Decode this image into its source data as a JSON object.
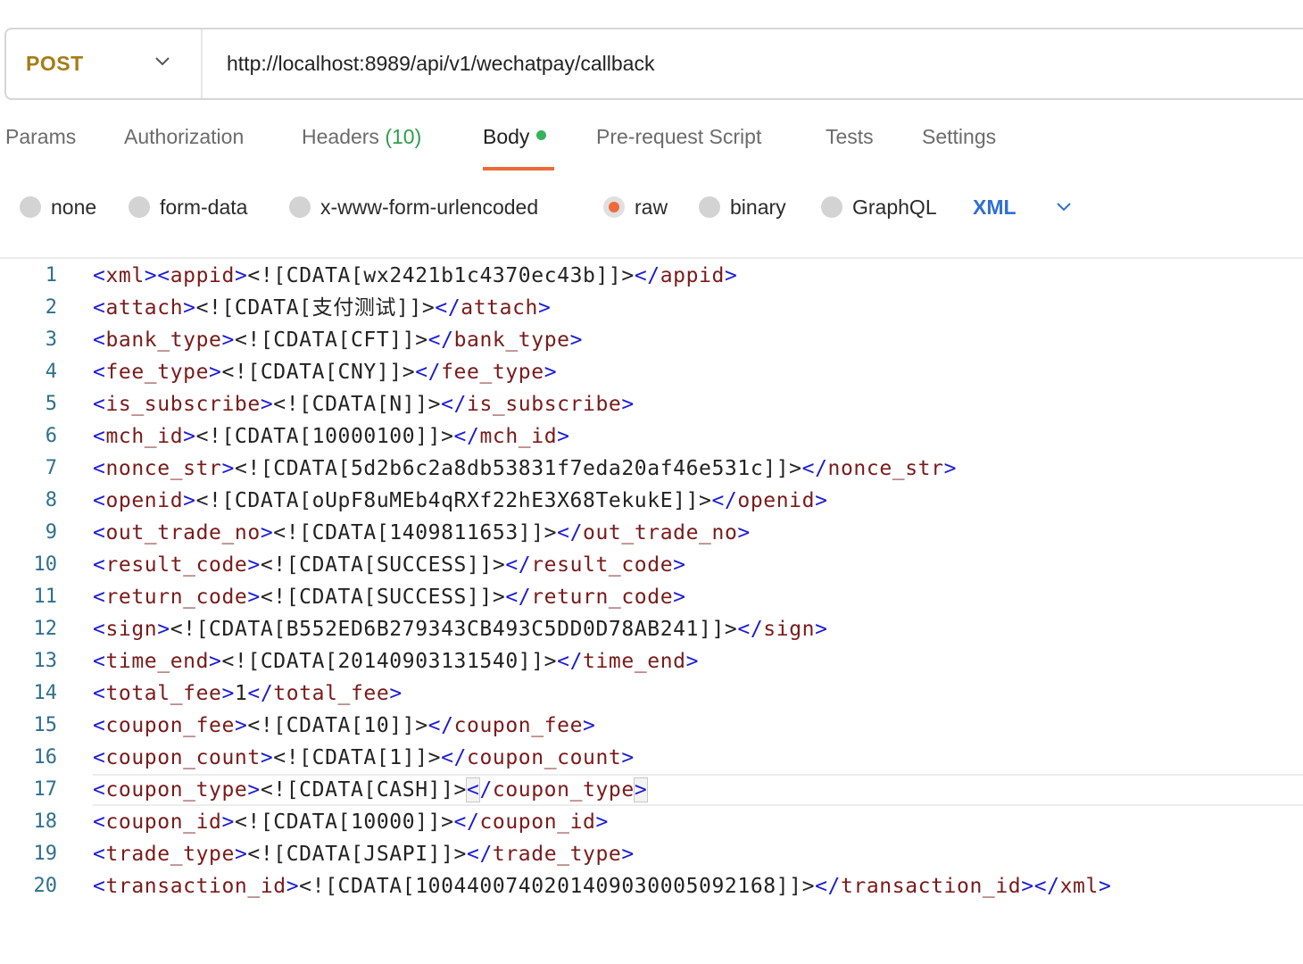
{
  "request": {
    "method": "POST",
    "url": "http://localhost:8989/api/v1/wechatpay/callback"
  },
  "tabs": [
    {
      "label": "Params"
    },
    {
      "label": "Authorization"
    },
    {
      "label": "Headers",
      "count": "(10)"
    },
    {
      "label": "Body",
      "active": true
    },
    {
      "label": "Pre-request Script"
    },
    {
      "label": "Tests"
    },
    {
      "label": "Settings"
    }
  ],
  "body_types": [
    {
      "label": "none"
    },
    {
      "label": "form-data"
    },
    {
      "label": "x-www-form-urlencoded"
    },
    {
      "label": "raw",
      "selected": true
    },
    {
      "label": "binary"
    },
    {
      "label": "GraphQL"
    }
  ],
  "language": "XML",
  "colors": {
    "method": "#a67c15",
    "active_underline": "#ec6a39",
    "body_dot": "#34b35a",
    "count": "#2e9e4a",
    "language": "#2f6fd4",
    "xml_punct": "#1a1ad6",
    "xml_tag": "#7a1a1a",
    "line_number": "#2e6f8e"
  },
  "editor": {
    "current_line": 17,
    "lines": [
      {
        "n": "1",
        "pre": "",
        "open": "xml><appid",
        "val": "<![CDATA[wx2421b1c4370ec43b]]>",
        "close": "appid"
      },
      {
        "n": "2",
        "pre": "",
        "open": "attach",
        "val": "<![CDATA[支付测试]]>",
        "close": "attach"
      },
      {
        "n": "3",
        "pre": "",
        "open": "bank_type",
        "val": "<![CDATA[CFT]]>",
        "close": "bank_type"
      },
      {
        "n": "4",
        "pre": "",
        "open": "fee_type",
        "val": "<![CDATA[CNY]]>",
        "close": "fee_type"
      },
      {
        "n": "5",
        "pre": "",
        "open": "is_subscribe",
        "val": "<![CDATA[N]]>",
        "close": "is_subscribe"
      },
      {
        "n": "6",
        "pre": "",
        "open": "mch_id",
        "val": "<![CDATA[10000100]]>",
        "close": "mch_id"
      },
      {
        "n": "7",
        "pre": "",
        "open": "nonce_str",
        "val": "<![CDATA[5d2b6c2a8db53831f7eda20af46e531c]]>",
        "close": "nonce_str"
      },
      {
        "n": "8",
        "pre": "",
        "open": "openid",
        "val": "<![CDATA[oUpF8uMEb4qRXf22hE3X68TekukE]]>",
        "close": "openid"
      },
      {
        "n": "9",
        "pre": "",
        "open": "out_trade_no",
        "val": "<![CDATA[1409811653]]>",
        "close": "out_trade_no"
      },
      {
        "n": "10",
        "pre": "",
        "open": "result_code",
        "val": "<![CDATA[SUCCESS]]>",
        "close": "result_code"
      },
      {
        "n": "11",
        "pre": "",
        "open": "return_code",
        "val": "<![CDATA[SUCCESS]]>",
        "close": "return_code"
      },
      {
        "n": "12",
        "pre": "",
        "open": "sign",
        "val": "<![CDATA[B552ED6B279343CB493C5DD0D78AB241]]>",
        "close": "sign"
      },
      {
        "n": "13",
        "pre": "",
        "open": "time_end",
        "val": "<![CDATA[20140903131540]]>",
        "close": "time_end"
      },
      {
        "n": "14",
        "pre": "",
        "open": "total_fee",
        "val": "1",
        "close": "total_fee"
      },
      {
        "n": "15",
        "pre": "",
        "open": "coupon_fee",
        "val": "<![CDATA[10]]>",
        "close": "coupon_fee"
      },
      {
        "n": "16",
        "pre": "",
        "open": "coupon_count",
        "val": "<![CDATA[1]]>",
        "close": "coupon_count"
      },
      {
        "n": "17",
        "pre": "",
        "open": "coupon_type",
        "val": "<![CDATA[CASH]]>",
        "close": "coupon_type"
      },
      {
        "n": "18",
        "pre": "",
        "open": "coupon_id",
        "val": "<![CDATA[10000]]>",
        "close": "coupon_id"
      },
      {
        "n": "19",
        "pre": "",
        "open": "trade_type",
        "val": "<![CDATA[JSAPI]]>",
        "close": "trade_type"
      },
      {
        "n": "20",
        "pre": "",
        "open": "transaction_id",
        "val": "<![CDATA[1004400740201409030005092168]]>",
        "close": "transaction_id></xml"
      }
    ]
  }
}
